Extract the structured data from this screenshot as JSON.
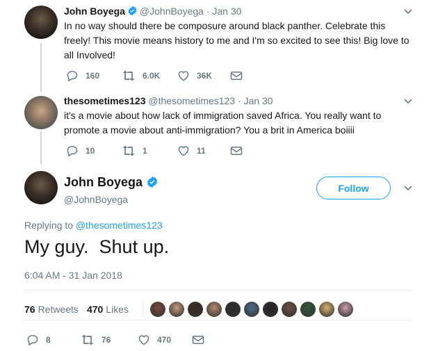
{
  "tweet1": {
    "name": "John Boyega",
    "handle_date": "@JohnBoyega · Jan 30",
    "text": "In no way should there be composure around black panther. Celebrate this freely! This movie means history to me and I'm so excited to see this! Big love to all Involved!",
    "replies": "160",
    "retweets": "6.0K",
    "likes": "36K"
  },
  "tweet2": {
    "name": "thesometimes123",
    "handle_date": "@thesometimes123 · Jan 30",
    "text": "it's a movie about how lack of immigration saved Africa. You really want to promote a movie about anti-immigration? You a brit in America boiiii",
    "replies": "10",
    "retweets": "1",
    "likes": "11"
  },
  "main": {
    "name": "John Boyega",
    "handle": "@JohnBoyega",
    "follow_label": "Follow",
    "replying_prefix": "Replying to ",
    "replying_to": "@thesometimes123",
    "text": "My guy.  Shut up.",
    "timestamp": "6:04 AM - 31 Jan 2018",
    "retweets_count": "76",
    "retweets_label": "Retweets",
    "likes_count": "470",
    "likes_label": "Likes",
    "replies": "8",
    "retweets": "76",
    "likes": "470"
  },
  "colors": {
    "accent": "#1da1f2",
    "muted": "#657786",
    "text": "#14171a"
  },
  "liker_colors": [
    "#7a4a3a",
    "#c79a7a",
    "#3b2a20",
    "#b98a70",
    "#2a2a2a",
    "#4a6d8a",
    "#222222",
    "#6a5040",
    "#2f5a3a",
    "#d8b56a",
    "#c7a0a8"
  ]
}
